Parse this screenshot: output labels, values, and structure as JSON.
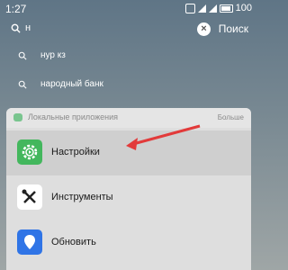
{
  "status": {
    "time": "1:27",
    "battery": "100"
  },
  "search": {
    "query": "н",
    "button_label": "Поиск"
  },
  "suggestions": [
    {
      "label": "нур кз"
    },
    {
      "label": "народный банк"
    }
  ],
  "panel": {
    "title": "Локальные приложения",
    "more_label": "Больше",
    "apps": [
      {
        "name": "Настройки",
        "icon": "settings-gear-icon",
        "color": "#43b75d"
      },
      {
        "name": "Инструменты",
        "icon": "tools-icon",
        "color": "#ffffff"
      },
      {
        "name": "Обновить",
        "icon": "update-icon",
        "color": "#2f74e6"
      }
    ]
  },
  "colors": {
    "annotation_arrow": "#e23a3a"
  }
}
